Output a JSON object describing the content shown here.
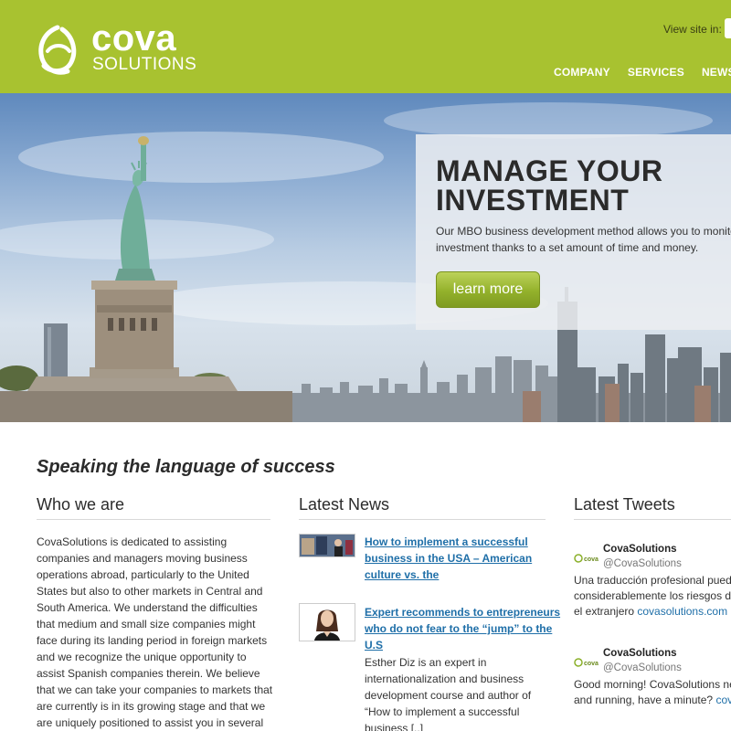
{
  "header": {
    "logo_word": "cova",
    "logo_sub": "SOLUTIONS",
    "view_site_label": "View site in:",
    "nav": [
      "COMPANY",
      "SERVICES",
      "NEWS"
    ]
  },
  "hero": {
    "title": "MANAGE YOUR INVESTMENT",
    "text_lines": [
      "Our MBO business development method allows you to monitor",
      "investment thanks to a set amount of time and money."
    ],
    "button": "learn more"
  },
  "tagline": "Speaking the language of success",
  "who": {
    "heading": "Who we are",
    "lines": [
      "CovaSolutions is dedicated to assisting",
      "companies and managers moving business",
      "operations abroad, particularly to the United",
      "States but also to other markets in Central and",
      "South America. We understand the difficulties",
      "that medium and small size companies might",
      "face during its landing period in foreign markets",
      "and we recognize the unique opportunity to",
      "assist Spanish companies therein. We believe",
      "that we can take your companies to markets that",
      "are currently is in its growing stage and that we",
      "are uniquely positioned to assist you in several"
    ]
  },
  "news": {
    "heading": "Latest News",
    "items": [
      {
        "title_lines": [
          "How to implement a successful",
          "business in the USA – American",
          "culture vs. the"
        ]
      },
      {
        "title_lines": [
          "Expert recommends to entrepreneurs",
          "who do not fear to the “jump” to the",
          "U.S"
        ]
      }
    ],
    "body_lines": [
      "Esther Diz is an expert in",
      "internationalization and business",
      "development course and author of",
      "“How to implement a successful",
      "business [..]"
    ]
  },
  "tweets": {
    "heading": "Latest Tweets",
    "items": [
      {
        "name": "CovaSolutions",
        "handle": "@CovaSolutions",
        "lines": [
          "Una traducción profesional puede r",
          "considerablemente los riesgos de",
          "el extranjero "
        ],
        "link": "covasolutions.com"
      },
      {
        "name": "CovaSolutions",
        "handle": "@CovaSolutions",
        "lines": [
          "Good morning! CovaSolutions new",
          "and running, have a minute? "
        ],
        "link": "covas"
      }
    ]
  },
  "colors": {
    "brand_green": "#a8c230",
    "link_blue": "#1f6fa8",
    "button_green": "#93b12b"
  }
}
